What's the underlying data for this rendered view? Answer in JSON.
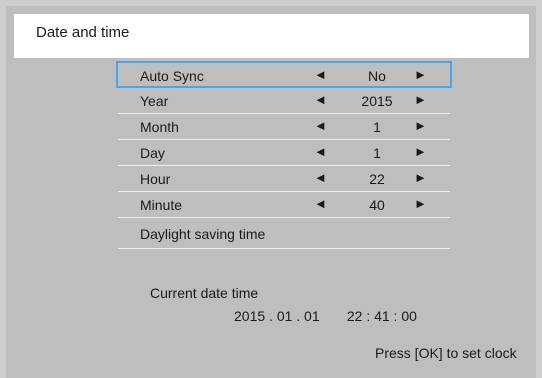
{
  "window": {
    "title": "Date and time"
  },
  "menu": {
    "items": [
      {
        "label": "Auto Sync",
        "value": "No",
        "left_arrow": "◄",
        "right_arrow": "►"
      },
      {
        "label": "Year",
        "value": "2015",
        "left_arrow": "◄",
        "right_arrow": "►"
      },
      {
        "label": "Month",
        "value": "1",
        "left_arrow": "◄",
        "right_arrow": "►"
      },
      {
        "label": "Day",
        "value": "1",
        "left_arrow": "◄",
        "right_arrow": "►"
      },
      {
        "label": "Hour",
        "value": "22",
        "left_arrow": "◄",
        "right_arrow": "►"
      },
      {
        "label": "Minute",
        "value": "40",
        "left_arrow": "◄",
        "right_arrow": "►"
      }
    ],
    "daylight_label": "Daylight saving time"
  },
  "current": {
    "label": "Current date time",
    "value": "2015 . 01 . 01       22 : 41 : 00"
  },
  "hint": "Press [OK] to set clock",
  "colors": {
    "selection_border": "#4aa6e8",
    "panel_bg": "#bebebe",
    "header_bg": "#ffffff"
  }
}
